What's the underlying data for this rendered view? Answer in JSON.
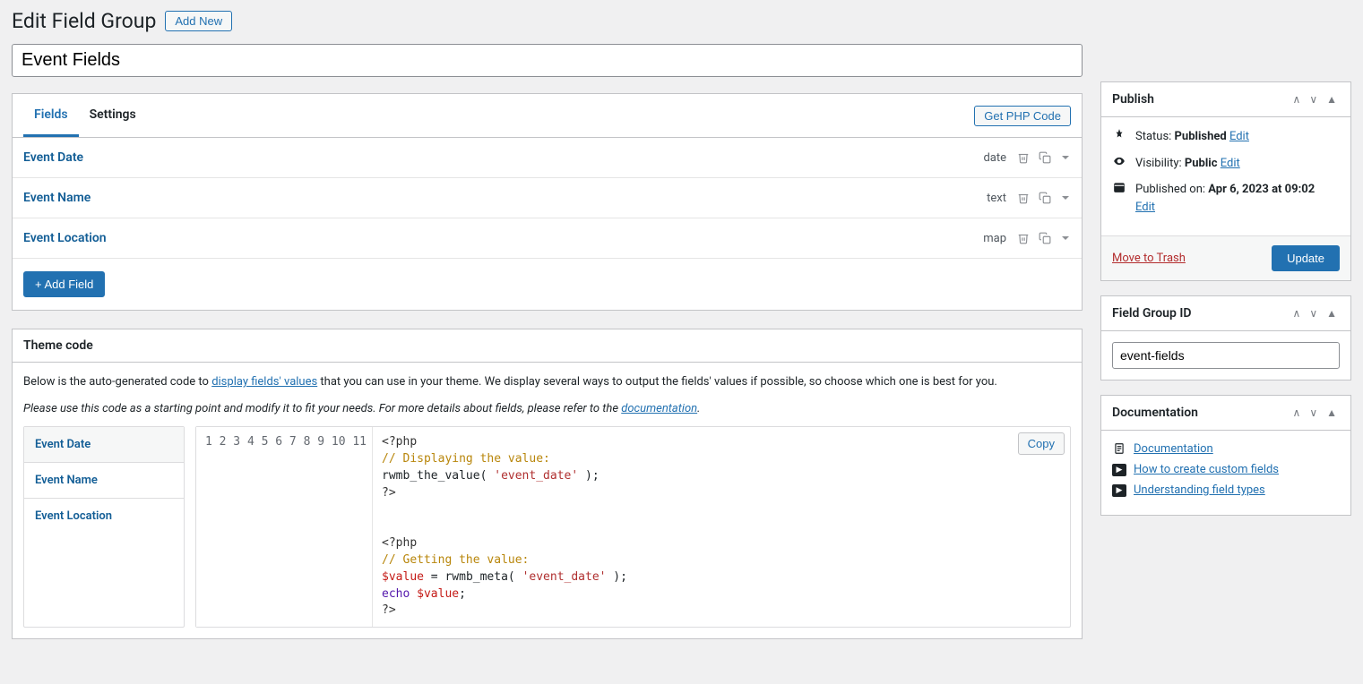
{
  "header": {
    "title": "Edit Field Group",
    "add_new": "Add New"
  },
  "title_value": "Event Fields",
  "tabs": {
    "fields": "Fields",
    "settings": "Settings",
    "get_php": "Get PHP Code"
  },
  "fields": [
    {
      "name": "Event Date",
      "type": "date"
    },
    {
      "name": "Event Name",
      "type": "text"
    },
    {
      "name": "Event Location",
      "type": "map"
    }
  ],
  "add_field": "+ Add Field",
  "theme_code": {
    "heading": "Theme code",
    "intro1a": "Below is the auto-generated code to ",
    "intro1_link": "display fields' values",
    "intro1b": " that you can use in your theme. We display several ways to output the fields' values if possible, so choose which one is best for you.",
    "intro2a": "Please use this code as a starting point and modify it to fit your needs. For more details about fields, please refer to the ",
    "intro2_link": "documentation",
    "tabs": [
      "Event Date",
      "Event Name",
      "Event Location"
    ],
    "copy": "Copy",
    "code": {
      "l1": "<?php",
      "l2": "// Displaying the value:",
      "l3a": "rwmb_the_value( ",
      "l3b": "'event_date'",
      "l3c": " );",
      "l4": "?>",
      "l7": "<?php",
      "l8": "// Getting the value:",
      "l9a": "$value",
      "l9b": " = rwmb_meta( ",
      "l9c": "'event_date'",
      "l9d": " );",
      "l10a": "echo ",
      "l10b": "$value",
      "l10c": ";",
      "l11": "?>"
    }
  },
  "publish": {
    "heading": "Publish",
    "status_label": "Status: ",
    "status_value": "Published",
    "edit": "Edit",
    "visibility_label": "Visibility: ",
    "visibility_value": "Public",
    "published_label": "Published on: ",
    "published_value": "Apr 6, 2023 at 09:02",
    "trash": "Move to Trash",
    "update": "Update"
  },
  "field_group_id": {
    "heading": "Field Group ID",
    "value": "event-fields"
  },
  "documentation": {
    "heading": "Documentation",
    "items": [
      "Documentation",
      "How to create custom fields",
      "Understanding field types"
    ]
  }
}
